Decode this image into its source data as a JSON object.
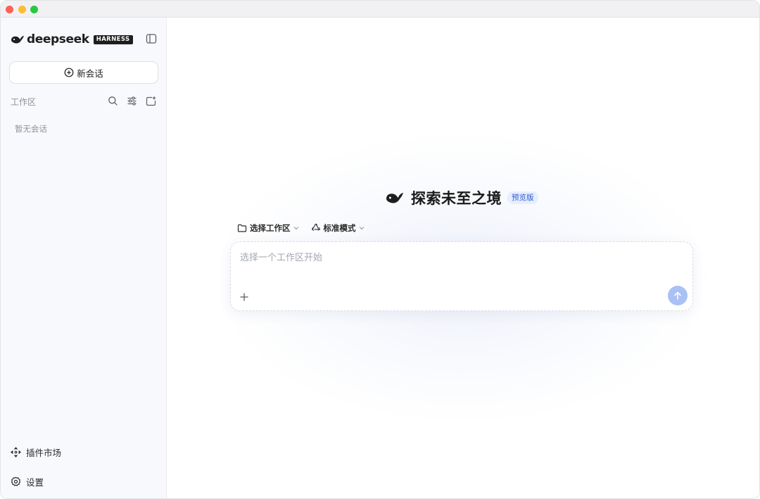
{
  "sidebar": {
    "brand": {
      "name": "deepseek",
      "badge": "HARNESS",
      "logo_icon": "whale-logo-icon"
    },
    "toggle_icon": "sidebar-toggle-icon",
    "new_chat": {
      "label": "新会话",
      "icon": "plus-circle-icon"
    },
    "workspace": {
      "label": "工作区",
      "icons": [
        "search-icon",
        "filter-icon",
        "new-folder-icon"
      ],
      "empty_text": "暂无会话"
    },
    "bottom_items": [
      {
        "label": "插件市场",
        "icon": "plugin-market-icon"
      },
      {
        "label": "设置",
        "icon": "gear-icon"
      }
    ]
  },
  "main": {
    "hero": {
      "title": "探索未至之境",
      "badge": "预览版",
      "logo_icon": "whale-logo-icon"
    },
    "options": [
      {
        "label": "选择工作区",
        "icon": "folder-icon"
      },
      {
        "label": "标准模式",
        "icon": "recycle-icon"
      }
    ],
    "composer": {
      "placeholder": "选择一个工作区开始",
      "value": "",
      "attach_icon": "plus-icon",
      "send_icon": "arrow-up-icon"
    }
  },
  "colors": {
    "sidebar_bg": "#f8f9fc",
    "accent": "#2f5bd3",
    "send_button": "#a9c1f5",
    "badge_bg": "#e7eefc"
  }
}
